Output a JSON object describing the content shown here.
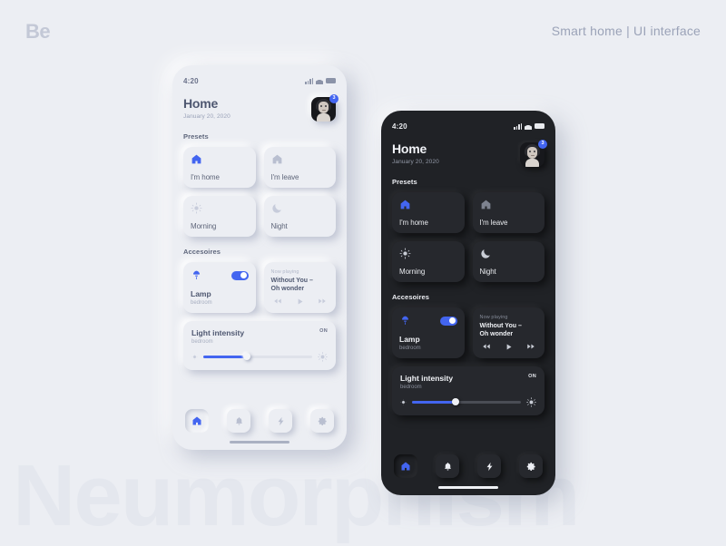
{
  "page": {
    "brand": "Be",
    "subtitle": "Smart home  |  UI interface",
    "watermark": "Neumorphism",
    "accent_color": "#4365f0",
    "background_color": "#eceef3",
    "dark_phone_color": "#202226"
  },
  "app": {
    "status": {
      "time": "4:20"
    },
    "header": {
      "title": "Home",
      "date": "January 20, 2020",
      "avatar_badge": "3"
    },
    "sections": {
      "presets_label": "Presets",
      "accessories_label": "Accesoires"
    },
    "presets": [
      {
        "label": "I'm home",
        "icon": "house-icon",
        "active": true
      },
      {
        "label": "I'm leave",
        "icon": "house-icon",
        "active": false
      },
      {
        "label": "Morning",
        "icon": "sun-icon",
        "active": false
      },
      {
        "label": "Night",
        "icon": "moon-icon",
        "active": false
      }
    ],
    "lamp": {
      "title": "Lamp",
      "subtitle": "bedroom",
      "icon": "lamp-icon",
      "toggle_on": true
    },
    "media": {
      "now_playing_label": "Now playing",
      "track_line1": "Without You –",
      "track_line2": "Oh wonder",
      "controls": [
        "rewind-icon",
        "play-icon",
        "forward-icon"
      ]
    },
    "light_intensity": {
      "title": "Light intensity",
      "subtitle": "bedroom",
      "status": "ON",
      "value_percent": 40,
      "low_icon": "dim-sun-icon",
      "high_icon": "bright-sun-icon"
    },
    "nav": [
      {
        "name": "home",
        "icon": "house-icon",
        "active": true
      },
      {
        "name": "notifications",
        "icon": "bell-icon",
        "active": false
      },
      {
        "name": "energy",
        "icon": "bolt-icon",
        "active": false
      },
      {
        "name": "settings",
        "icon": "gear-icon",
        "active": false
      }
    ]
  }
}
